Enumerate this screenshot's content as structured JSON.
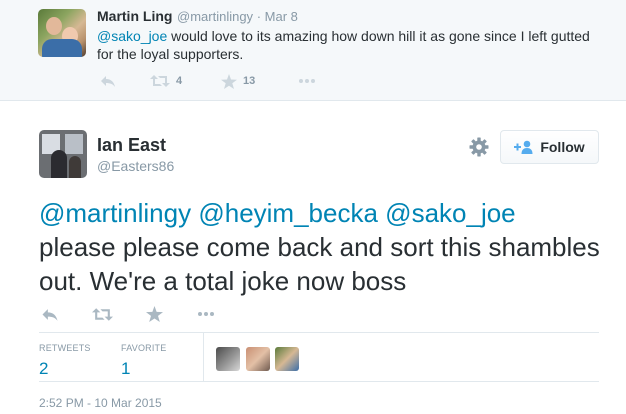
{
  "parent_tweet": {
    "name": "Martin Ling",
    "handle": "@martinlingy",
    "separator": "·",
    "date": "Mar 8",
    "mention": "@sako_joe",
    "text": " would love to its amazing how down hill it as gone since I left gutted for the loyal supporters.",
    "retweet_count": "4",
    "favorite_count": "13"
  },
  "main_tweet": {
    "name": "Ian East",
    "handle": "@Easters86",
    "follow_label": "Follow",
    "mentions": [
      "@martinlingy",
      "@heyim_becka",
      "@sako_joe"
    ],
    "text": "please please come back and sort this shambles out. We're a total joke now boss",
    "stats": {
      "retweets_label": "RETWEETS",
      "retweets_count": "2",
      "favorites_label": "FAVORITE",
      "favorites_count": "1"
    },
    "timestamp": "2:52 PM - 10 Mar 2015"
  },
  "colors": {
    "link": "#0084b4",
    "muted": "#8899a6",
    "text": "#292f33",
    "parent_bg": "#f5f8fa"
  },
  "icons": {
    "reply": "reply-icon",
    "retweet": "retweet-icon",
    "favorite": "star-icon",
    "more": "more-dots-icon",
    "gear": "gear-icon",
    "follow": "add-user-icon"
  }
}
